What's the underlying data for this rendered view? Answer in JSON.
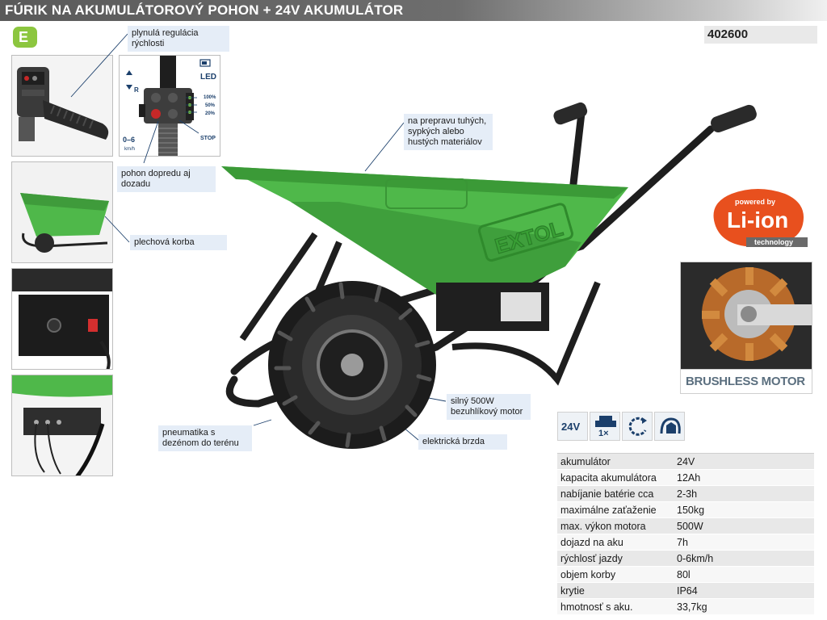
{
  "header": {
    "title": "FÚRIK NA AKUMULÁTOROVÝ POHON + 24V AKUMULÁTOR",
    "product_code": "402600",
    "category_badge": "E"
  },
  "callouts": {
    "speed_regulation": "plynulá regulácia rýchlosti",
    "forward_reverse": "pohon dopredu aj dozadu",
    "sheet_body": "plechová korba",
    "transport": "na prepravu tuhých, sypkých alebo hustých materiálov",
    "motor": "silný 500W bezuhlíkový motor",
    "brake": "elektrická brzda",
    "tire": "pneumatika s dezénom do terénu"
  },
  "control_panel": {
    "led": "LED",
    "r": "R",
    "speed": "0–6",
    "speed_unit": "km/h",
    "levels": [
      "100%",
      "50%",
      "20%"
    ],
    "stop": "STOP"
  },
  "badges": {
    "powered_by": "powered by",
    "li_ion": "Li-ion",
    "technology": "technology",
    "brushless": "BRUSHLESS MOTOR",
    "brand": "EXTOL",
    "voltage": "24V",
    "one_x": "1×"
  },
  "specs": [
    {
      "label": "akumulátor",
      "value": "24V"
    },
    {
      "label": "kapacita akumulátora",
      "value": "12Ah"
    },
    {
      "label": "nabíjanie batérie cca",
      "value": "2-3h"
    },
    {
      "label": "maximálne zaťaženie",
      "value": "150kg"
    },
    {
      "label": "max. výkon motora",
      "value": "500W"
    },
    {
      "label": "dojazd na aku",
      "value": "7h"
    },
    {
      "label": "rýchlosť jazdy",
      "value": "0-6km/h"
    },
    {
      "label": "objem korby",
      "value": "80l"
    },
    {
      "label": "krytie",
      "value": "IP64"
    },
    {
      "label": "hmotnosť s aku.",
      "value": "33,7kg"
    }
  ],
  "colors": {
    "body_green": "#4fb84a",
    "badge_green": "#8cc63f",
    "liion_orange": "#e8501e",
    "header_gray": "#5a5a5a",
    "callout_blue": "#e5edf7"
  },
  "icons": [
    "battery-icon",
    "speed-dial-icon",
    "rotate-icon",
    "hand-brake-icon",
    "handlebar-icon"
  ]
}
